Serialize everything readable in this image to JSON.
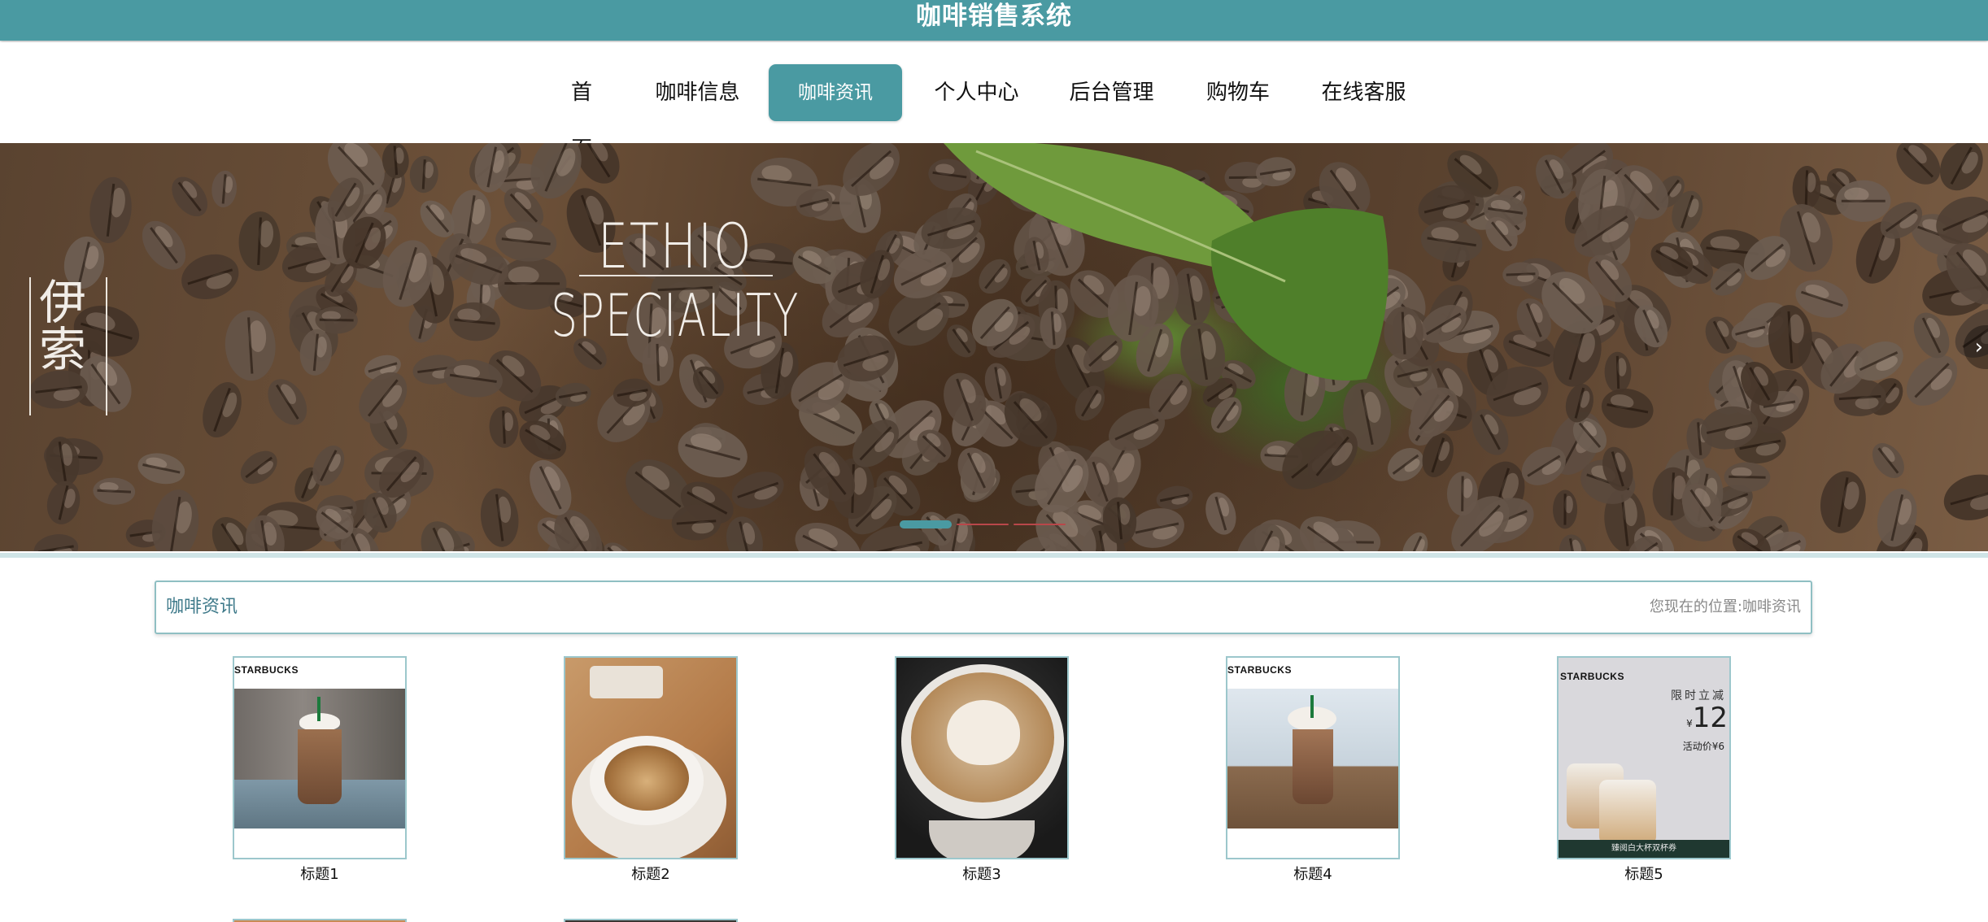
{
  "app": {
    "title": "咖啡销售系统"
  },
  "nav": {
    "items": [
      {
        "label": "首页",
        "active": false
      },
      {
        "label": "咖啡信息",
        "active": false
      },
      {
        "label": "咖啡资讯",
        "active": true
      },
      {
        "label": "个人中心",
        "active": false
      },
      {
        "label": "后台管理",
        "active": false
      },
      {
        "label": "购物车",
        "active": false
      },
      {
        "label": "在线客服",
        "active": false
      }
    ]
  },
  "banner": {
    "title_line1": "ETHIO",
    "title_line2": "SPECIALITY",
    "vertical_text": "伊索",
    "next_icon": "chevron-right-icon",
    "slide_count": 3,
    "active_slide": 1
  },
  "section": {
    "title": "咖啡资讯",
    "breadcrumb_prefix": "您现在的位置:",
    "breadcrumb_current": "咖啡资讯"
  },
  "cards": [
    {
      "title": "标题1",
      "logo": "STARBUCKS",
      "image": "frappuccino-cream"
    },
    {
      "title": "标题2",
      "logo": "",
      "image": "latte-cup-table"
    },
    {
      "title": "标题3",
      "logo": "",
      "image": "latte-art-heart"
    },
    {
      "title": "标题4",
      "logo": "STARBUCKS",
      "image": "mocha-frappuccino"
    },
    {
      "title": "标题5",
      "logo": "STARBUCKS",
      "image": "promo-cups",
      "promo_line1": "限时立减",
      "promo_price": "12",
      "promo_currency": "¥",
      "promo_line2": "活动价¥6",
      "promo_footer": "臻阅白大杯双杯券"
    }
  ],
  "colors": {
    "primary": "#4a9aa2",
    "section_title": "#3f7a8a",
    "border": "#9cc7cc"
  }
}
